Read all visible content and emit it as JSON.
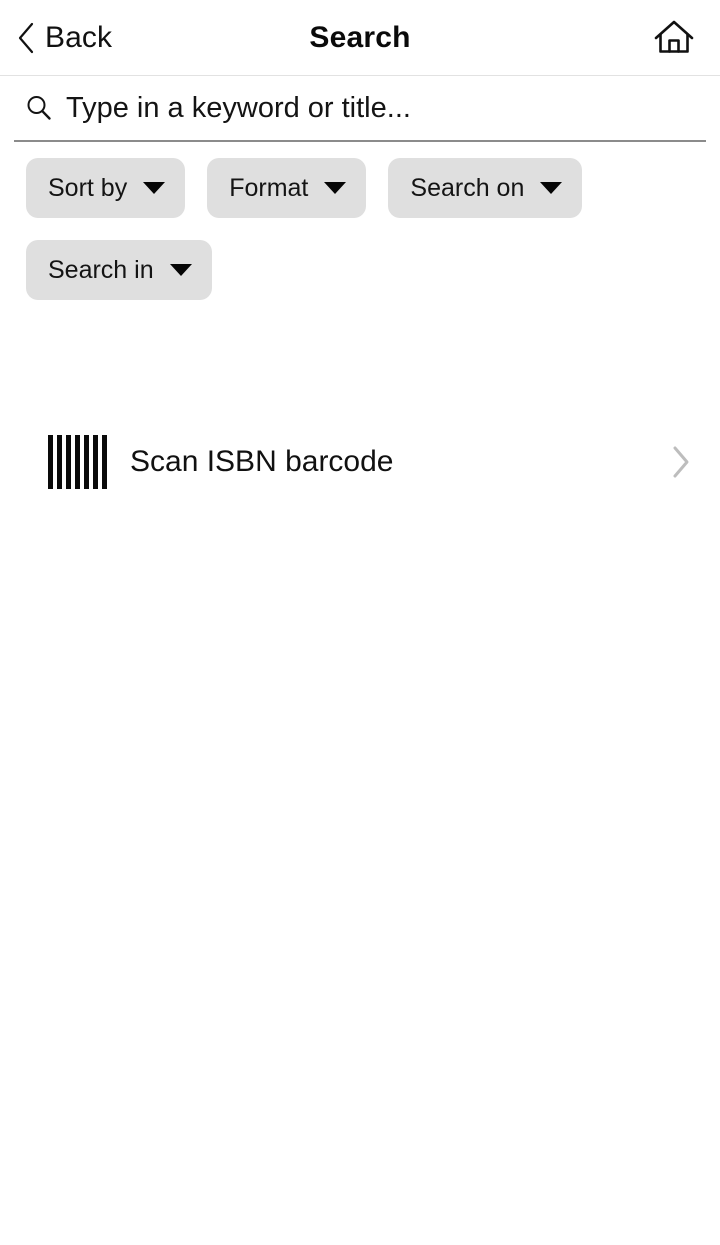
{
  "header": {
    "back_label": "Back",
    "title": "Search",
    "back_icon": "chevron-left-icon",
    "home_icon": "home-icon"
  },
  "search": {
    "placeholder": "Type in a keyword or title...",
    "value": "",
    "icon": "search-icon"
  },
  "filters": {
    "chips": [
      {
        "label": "Sort by",
        "icon": "chevron-down-icon"
      },
      {
        "label": "Format",
        "icon": "chevron-down-icon"
      },
      {
        "label": "Search on",
        "icon": "chevron-down-icon"
      },
      {
        "label": "Search in",
        "icon": "chevron-down-icon"
      }
    ]
  },
  "actions": {
    "scan": {
      "label": "Scan ISBN barcode",
      "leading_icon": "barcode-icon",
      "trailing_icon": "chevron-right-icon",
      "bar_count": 7
    }
  },
  "colors": {
    "background": "#ffffff",
    "text": "#111111",
    "chip_background": "#dfdfdf",
    "divider": "#e2e2e2",
    "search_underline": "#8b8b8b",
    "chevron_muted": "#bdbdbd"
  }
}
